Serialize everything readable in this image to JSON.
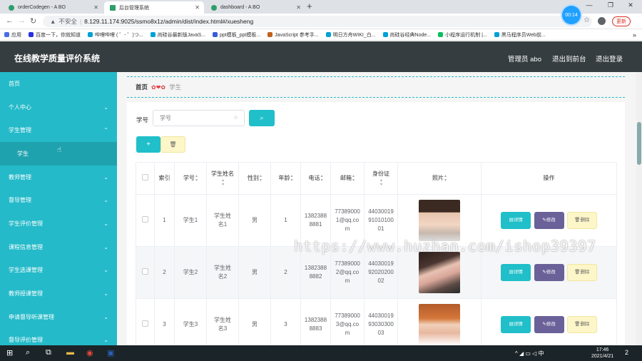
{
  "browser": {
    "tabs": [
      {
        "label": "orderCodegen - A BO",
        "active": false
      },
      {
        "label": "后台管理系统",
        "active": true
      },
      {
        "label": "dashboard - A BO",
        "active": false
      }
    ],
    "new_tab": "+",
    "url": "8.129.11.174:9025/ssmo8x1z/admin/dist/index.html#/xuesheng",
    "security_label": "不安全",
    "timer": "00:14",
    "update_label": "更新",
    "bookmarks": [
      "应用",
      "百度一下，你就知道",
      "哔哩哔哩 ( ゜- ゜)つ...",
      "尚硅谷最新版JavaS...",
      "ppt模板_ppt模板...",
      "JavaScript 参考手...",
      "明日方舟WIKI_白...",
      "尚硅谷经典Node...",
      "小程序运行机制 |...",
      "黑马程序员Web前..."
    ]
  },
  "app": {
    "title": "在线教学质量评价系统",
    "header_links": {
      "admin": "管理员 abo",
      "frontend": "退出到前台",
      "logout": "退出登录"
    }
  },
  "sidebar": {
    "items": [
      {
        "label": "首页",
        "chevron": ""
      },
      {
        "label": "个人中心",
        "chevron": "⌄"
      },
      {
        "label": "学生管理",
        "chevron": "⌃"
      },
      {
        "label": "学生",
        "chevron": ""
      },
      {
        "label": "教师管理",
        "chevron": "⌄"
      },
      {
        "label": "督导管理",
        "chevron": "⌄"
      },
      {
        "label": "学生评价管理",
        "chevron": "⌄"
      },
      {
        "label": "课程信息管理",
        "chevron": "⌄"
      },
      {
        "label": "学生选课管理",
        "chevron": "⌄"
      },
      {
        "label": "教师授课管理",
        "chevron": "⌄"
      },
      {
        "label": "申请督导听课管理",
        "chevron": "⌄"
      },
      {
        "label": "督导评价管理",
        "chevron": "⌄"
      }
    ]
  },
  "breadcrumb": {
    "home": "首页",
    "sep": "✿❤✿",
    "current": "学生"
  },
  "search": {
    "label": "学号",
    "placeholder": "学号",
    "button_icon": "⌕"
  },
  "toolbar": {
    "add_label": "+",
    "delete_label": "🗑"
  },
  "table": {
    "headers": [
      "索引",
      "学号",
      "学生姓名",
      "性别",
      "年龄",
      "电话",
      "邮箱",
      "身份证",
      "照片",
      "操作"
    ],
    "rows": [
      {
        "index": "1",
        "id": "学生1",
        "name": "学生姓名1",
        "gender": "男",
        "age": "1",
        "phone": "13823888881",
        "email": "773890001@qq.com",
        "idcard": "440300199101010001"
      },
      {
        "index": "2",
        "id": "学生2",
        "name": "学生姓名2",
        "gender": "男",
        "age": "2",
        "phone": "13823888882",
        "email": "773890002@qq.com",
        "idcard": "440300199202020002"
      },
      {
        "index": "3",
        "id": "学生3",
        "name": "学生姓名3",
        "gender": "男",
        "age": "3",
        "phone": "13823888883",
        "email": "773890003@qq.com",
        "idcard": "440300199303030003"
      }
    ],
    "actions": {
      "detail": "详情",
      "edit": "修改",
      "delete": "删除"
    }
  },
  "watermark": "https://www.huzhan.com/ishop39397",
  "taskbar": {
    "tray": "^ ◢ ▭ ◁ 中",
    "time": "17:46",
    "date": "2021/4/21",
    "notif_count": "2"
  },
  "colors": {
    "sidebar": "#24bac9",
    "header": "#363d40",
    "accent": "#20bfc9",
    "edit": "#6b6199",
    "delete": "#fdf6c8"
  }
}
